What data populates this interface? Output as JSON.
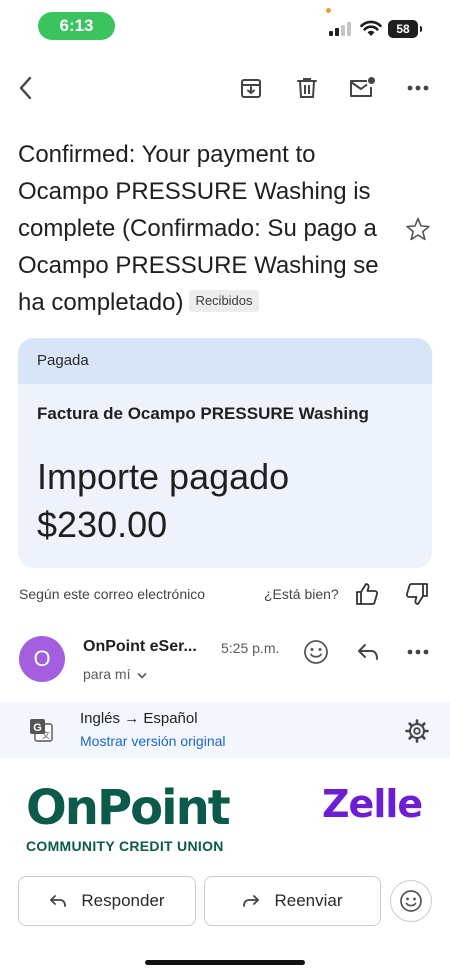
{
  "status_bar": {
    "time": "6:13",
    "battery": "58"
  },
  "toolbar": {
    "back_icon": "chevron-left-icon",
    "archive_icon": "archive-icon",
    "delete_icon": "trash-icon",
    "unread_icon": "mark-unread-icon",
    "more_icon": "more-horizontal-icon"
  },
  "email": {
    "subject": "Confirmed: Your payment to Ocampo PRESSURE Washing is complete (Confirmado: Su pago a Ocampo PRESSURE Washing se ha completado)",
    "label": "Recibidos",
    "card": {
      "status": "Pagada",
      "title": "Factura de Ocampo PRESSURE Washing",
      "amount_label": "Importe pagado",
      "amount": "$230.00"
    },
    "feedback": {
      "text": "Según este correo electrónico",
      "question": "¿Está bien?"
    },
    "sender": {
      "initial": "O",
      "name": "OnPoint eSer...",
      "time": "5:25 p.m.",
      "recipient": "para mí"
    },
    "translation": {
      "languages": "Inglés → Español",
      "show_original": "Mostrar versión original"
    },
    "body": {
      "bank_logo_name": "OnPoint",
      "bank_logo_tagline": "COMMUNITY CREDIT UNION",
      "payment_logo": "Zelle"
    }
  },
  "actions": {
    "reply_label": "Responder",
    "forward_label": "Reenviar"
  },
  "colors": {
    "avatar": "#a45ee0",
    "card_header": "#d8e5f8",
    "link": "#1a67c9",
    "onpoint_green": "#0b5a4a",
    "zelle_purple": "#6d1ed4"
  }
}
